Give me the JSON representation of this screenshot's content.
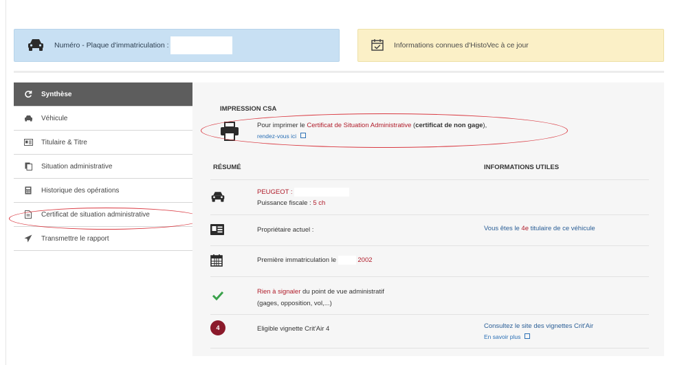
{
  "header": {
    "plate_label": "Numéro - Plaque d'immatriculation :",
    "info_label": "Informations connues d'HistoVec à ce jour"
  },
  "sidebar": {
    "items": [
      {
        "label": "Synthèse",
        "icon": "refresh-icon",
        "active": true
      },
      {
        "label": "Véhicule",
        "icon": "car-icon"
      },
      {
        "label": "Titulaire & Titre",
        "icon": "id-card-icon"
      },
      {
        "label": "Situation administrative",
        "icon": "document-icon"
      },
      {
        "label": "Historique des opérations",
        "icon": "calculator-icon"
      },
      {
        "label": "Certificat de situation administrative",
        "icon": "file-icon"
      },
      {
        "label": "Transmettre le rapport",
        "icon": "send-icon"
      }
    ]
  },
  "impression": {
    "title": "IMPRESSION CSA",
    "text_before": "Pour imprimer le",
    "certificate_link": "Certificat de Situation Administrative",
    "text_paren_open": "(",
    "bold_text": "certificat de non gage",
    "text_paren_close": "),",
    "here_link": "rendez-vous ici"
  },
  "resume": {
    "title": "RÉSUMÉ",
    "useful_title": "INFORMATIONS UTILES",
    "brand": "PEUGEOT :",
    "power_label": "Puissance fiscale :",
    "power_value": "5 ch",
    "owner_label": "Propriétaire actuel :",
    "owner_info_prefix": "Vous êtes le",
    "owner_info_rank": "4e",
    "owner_info_suffix": "titulaire de ce véhicule",
    "first_reg_label": "Première immatriculation le",
    "first_reg_year": "2002",
    "nothing_red": "Rien à signaler",
    "nothing_rest": "du point de vue administratif",
    "nothing_detail": "(gages, opposition, vol,...)",
    "critair_badge": "4",
    "critair_label": "Eligible vignette Crit'Air 4",
    "critair_site": "Consultez le site des vignettes Crit'Air",
    "critair_more": "En savoir plus"
  },
  "colors": {
    "plate_bg": "#c8e0f3",
    "info_bg": "#fbf0c7",
    "accent_red": "#b01c2a",
    "link_blue": "#2a6fb5",
    "annotation_red": "#d9363e",
    "check_green": "#3aa14b",
    "critair_badge": "#8b1a2b"
  }
}
